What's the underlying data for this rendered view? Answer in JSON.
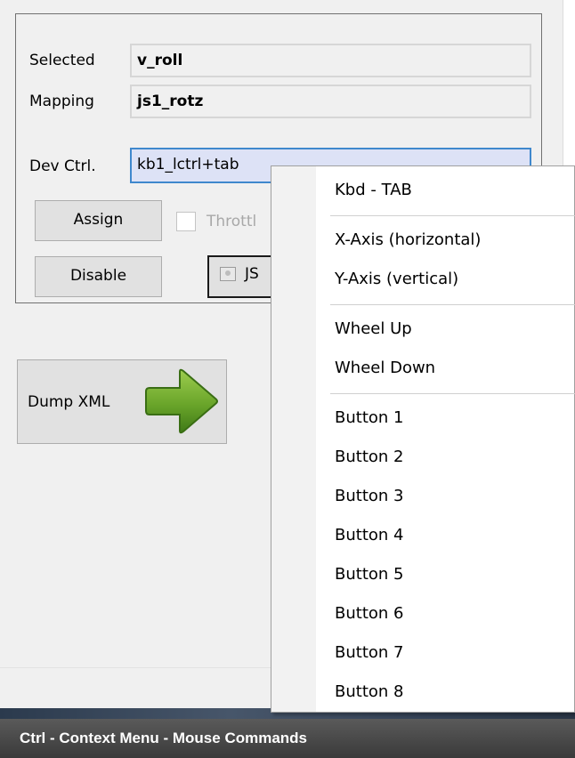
{
  "form": {
    "selected_label": "Selected",
    "selected_value": "v_roll",
    "mapping_label": "Mapping",
    "mapping_value": "js1_rotz",
    "devctrl_label": "Dev Ctrl.",
    "devctrl_value": "kb1_lctrl+tab",
    "assign_label": "Assign",
    "throttle_label": "Throttl",
    "throttle_checked": false,
    "disable_label": "Disable",
    "js_button_label": "JS"
  },
  "dump_button": {
    "label": "Dump XML",
    "icon": "green-arrow-right-icon"
  },
  "context_menu": {
    "groups": [
      [
        "Kbd - TAB"
      ],
      [
        "X-Axis (horizontal)",
        "Y-Axis (vertical)"
      ],
      [
        "Wheel Up",
        "Wheel Down"
      ],
      [
        "Button 1",
        "Button 2",
        "Button 3",
        "Button 4",
        "Button 5",
        "Button 6",
        "Button 7",
        "Button 8"
      ]
    ]
  },
  "caption": "Ctrl - Context Menu - Mouse Commands",
  "colors": {
    "edit_field_bg": "#dde2f6",
    "edit_field_border": "#3f88cd",
    "arrow_green": "#6aa52a",
    "caption_bg": "#444444"
  }
}
